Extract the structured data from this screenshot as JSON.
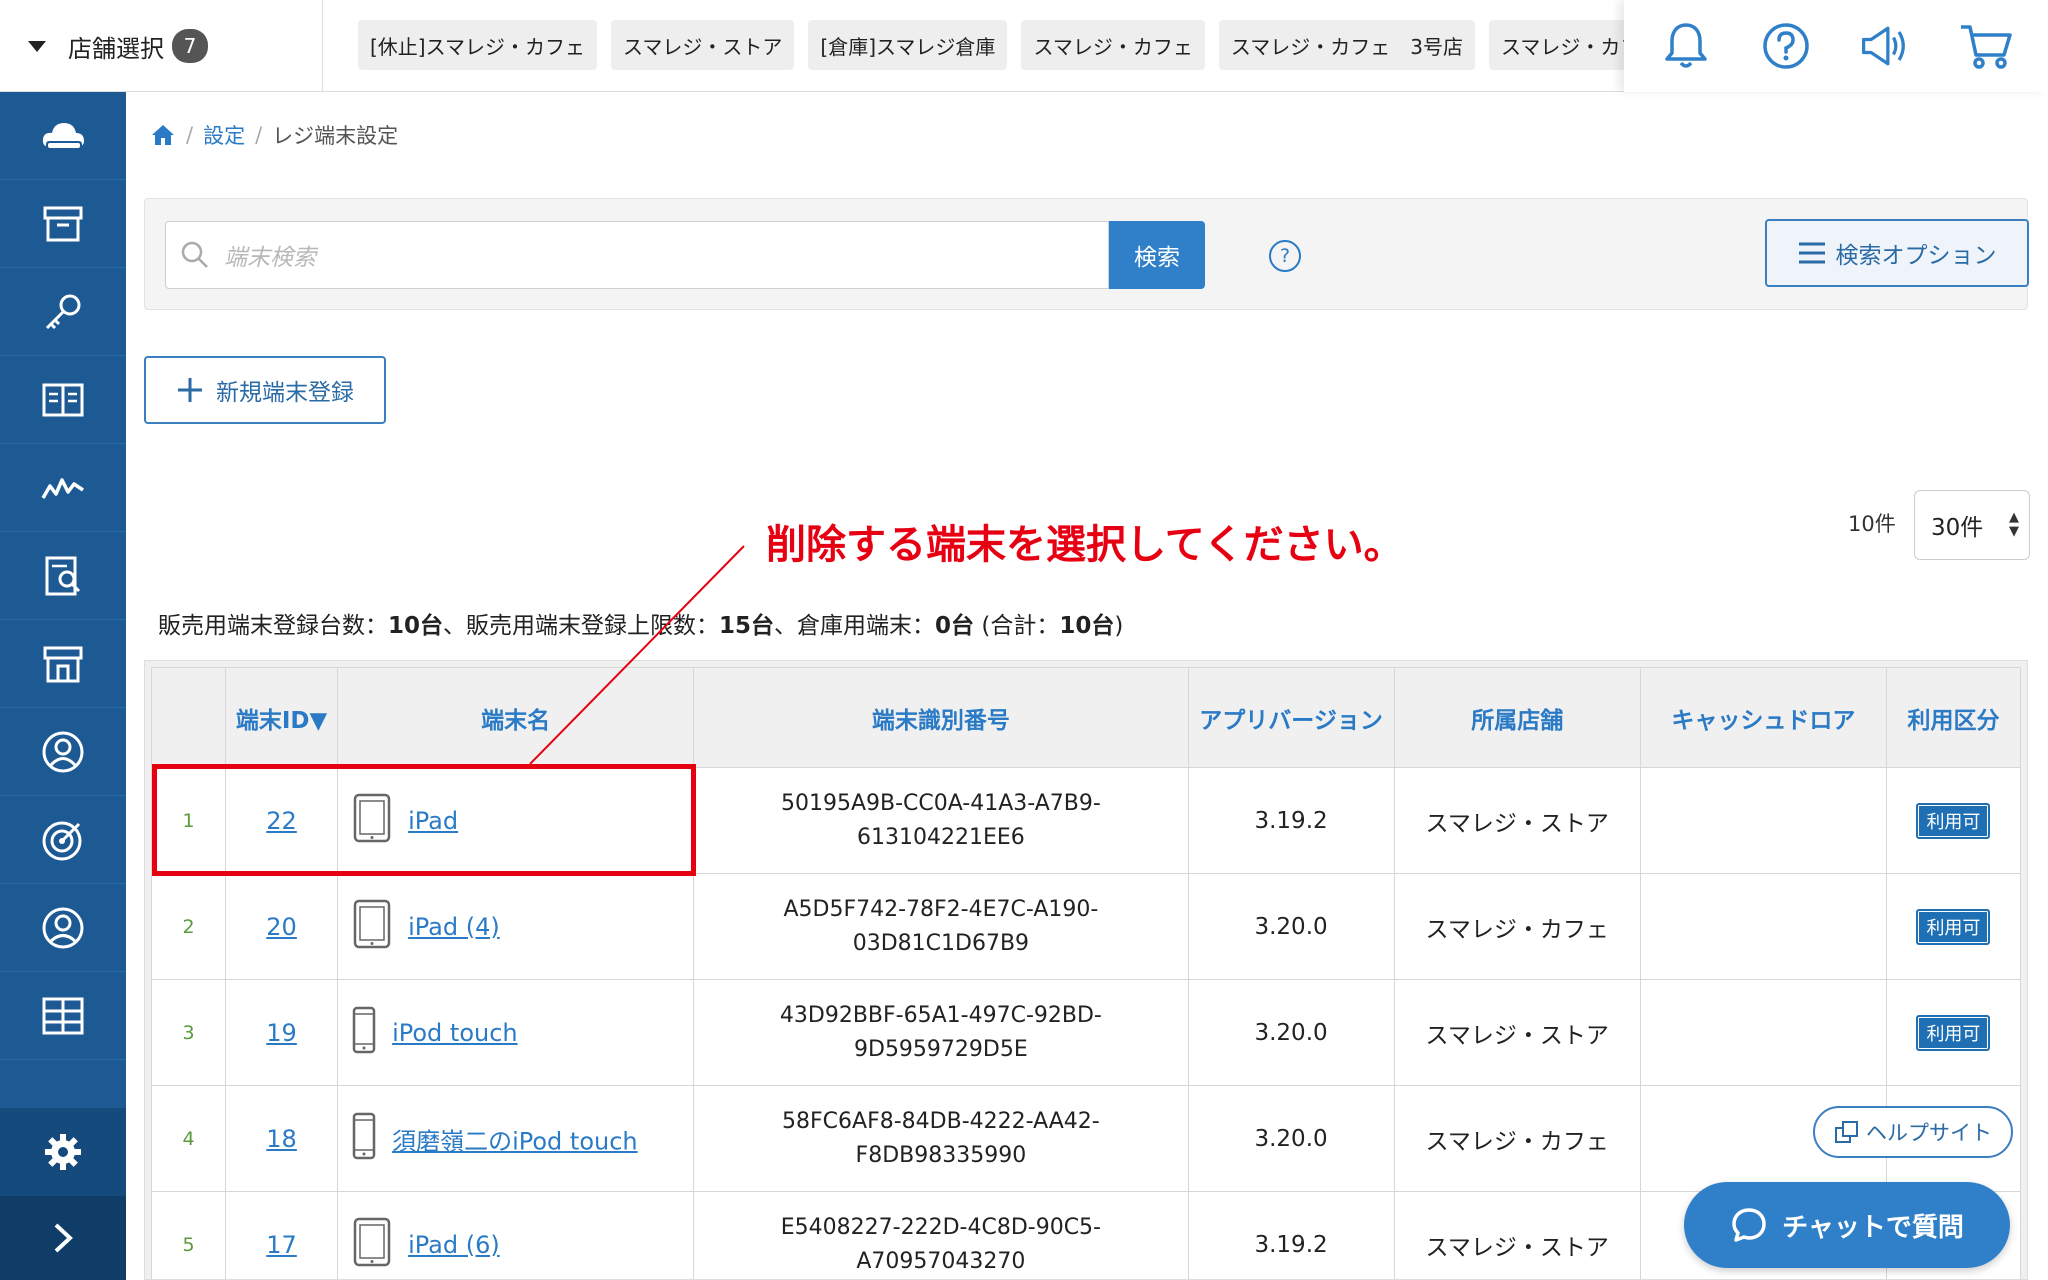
{
  "topbar": {
    "store_select_label": "店舗選択",
    "store_count": "7",
    "store_tabs": [
      "[休止]スマレジ・カフェ",
      "スマレジ・ストア",
      "[倉庫]スマレジ倉庫",
      "スマレジ・カフェ",
      "スマレジ・カフェ　3号店",
      "スマレジ・カフェ"
    ],
    "icons": [
      "bell-icon",
      "question-icon",
      "megaphone-icon",
      "cart-icon"
    ]
  },
  "sidebar": {
    "icons": [
      "cloud-icon",
      "archive-icon",
      "key-icon",
      "book-icon",
      "chart-icon",
      "report-icon",
      "store-icon",
      "user-icon",
      "target-icon",
      "account-icon",
      "grid-icon"
    ],
    "bottom": [
      "gear-icon",
      "chevron-right-icon"
    ]
  },
  "breadcrumb": {
    "settings": "設定",
    "current": "レジ端末設定"
  },
  "search": {
    "placeholder": "端末検索",
    "button": "検索",
    "help": "?",
    "options_button": "検索オプション"
  },
  "new_button": "新規端末登録",
  "per_page": {
    "label": "10件",
    "selected": "30件"
  },
  "annotation": "削除する端末を選択してください。",
  "summary": {
    "label1": "販売用端末登録台数：",
    "value1": "10台",
    "label2": "、販売用端末登録上限数：",
    "value2": "15台",
    "label3": "、倉庫用端末：",
    "value3": "0台",
    "label4": " (合計：",
    "value4": "10台",
    "label5": ")"
  },
  "table": {
    "headers": {
      "id": "端末ID▼",
      "name": "端末名",
      "ident": "端末識別番号",
      "app_version": "アプリバージョン",
      "store": "所属店舗",
      "cash_drawer": "キャッシュドロア",
      "usage": "利用区分"
    },
    "rows": [
      {
        "no": "1",
        "id": "22",
        "device": "tablet",
        "name": "iPad",
        "ident1": "50195A9B-CC0A-41A3-A7B9-",
        "ident2": "613104221EE6",
        "version": "3.19.2",
        "store": "スマレジ・ストア",
        "drawer": "",
        "usage": "利用可"
      },
      {
        "no": "2",
        "id": "20",
        "device": "tablet",
        "name": "iPad (4)",
        "ident1": "A5D5F742-78F2-4E7C-A190-",
        "ident2": "03D81C1D67B9",
        "version": "3.20.0",
        "store": "スマレジ・カフェ",
        "drawer": "",
        "usage": "利用可"
      },
      {
        "no": "3",
        "id": "19",
        "device": "phone",
        "name": "iPod touch",
        "ident1": "43D92BBF-65A1-497C-92BD-",
        "ident2": "9D5959729D5E",
        "version": "3.20.0",
        "store": "スマレジ・ストア",
        "drawer": "",
        "usage": "利用可"
      },
      {
        "no": "4",
        "id": "18",
        "device": "phone",
        "name": "須磨嶺二のiPod touch",
        "ident1": "58FC6AF8-84DB-4222-AA42-",
        "ident2": "F8DB98335990",
        "version": "3.20.0",
        "store": "スマレジ・カフェ",
        "drawer": "",
        "usage": ""
      },
      {
        "no": "5",
        "id": "17",
        "device": "tablet",
        "name": "iPad (6)",
        "ident1": "E5408227-222D-4C8D-90C5-",
        "ident2": "A70957043270",
        "version": "3.19.2",
        "store": "スマレジ・ストア",
        "drawer": "",
        "usage": ""
      }
    ]
  },
  "help_site": "ヘルプサイト",
  "chat_button": "チャットで質問",
  "colors": {
    "sidebar": "#1d5a94",
    "accent": "#2f80c8",
    "annotation": "#e60012",
    "link": "#2a7ac6"
  }
}
